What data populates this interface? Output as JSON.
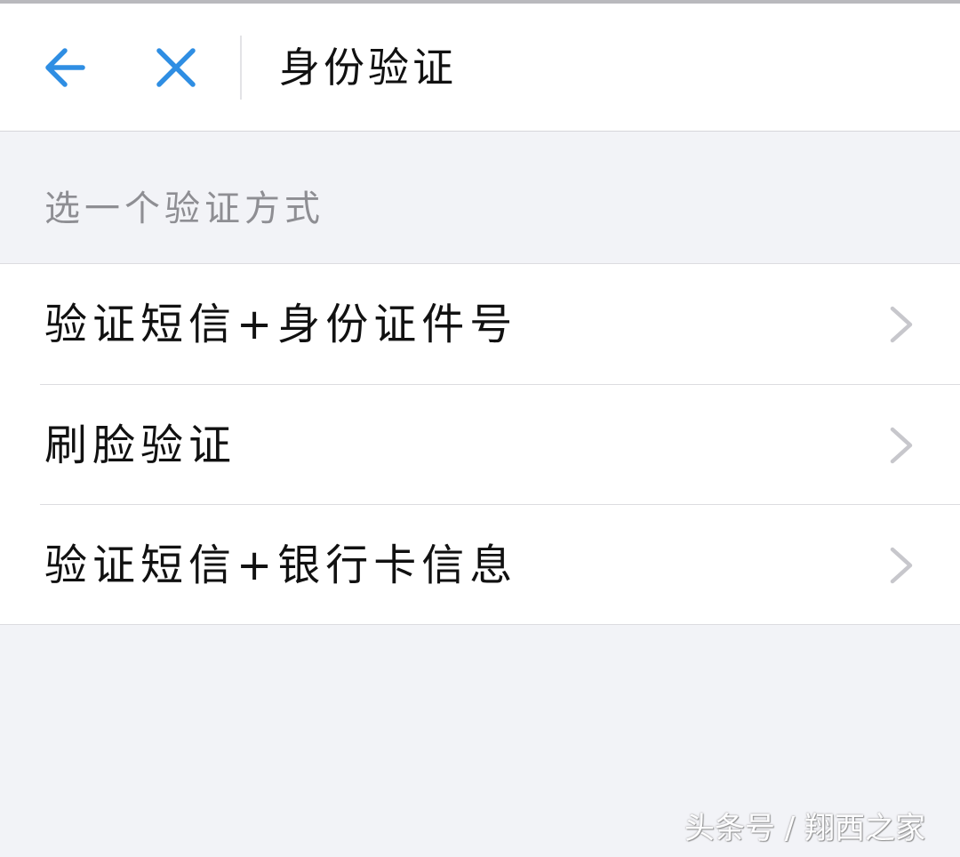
{
  "header": {
    "title": "身份验证",
    "back_icon": "arrow-left-icon",
    "close_icon": "close-icon",
    "accent_color": "#2f8ee3"
  },
  "section": {
    "header": "选一个验证方式"
  },
  "options": [
    {
      "label": "验证短信+身份证件号",
      "icon": "chevron-right-icon"
    },
    {
      "label": "刷脸验证",
      "icon": "chevron-right-icon"
    },
    {
      "label": "验证短信+银行卡信息",
      "icon": "chevron-right-icon"
    }
  ],
  "watermark": {
    "text": "头条号 / 翔西之家"
  }
}
